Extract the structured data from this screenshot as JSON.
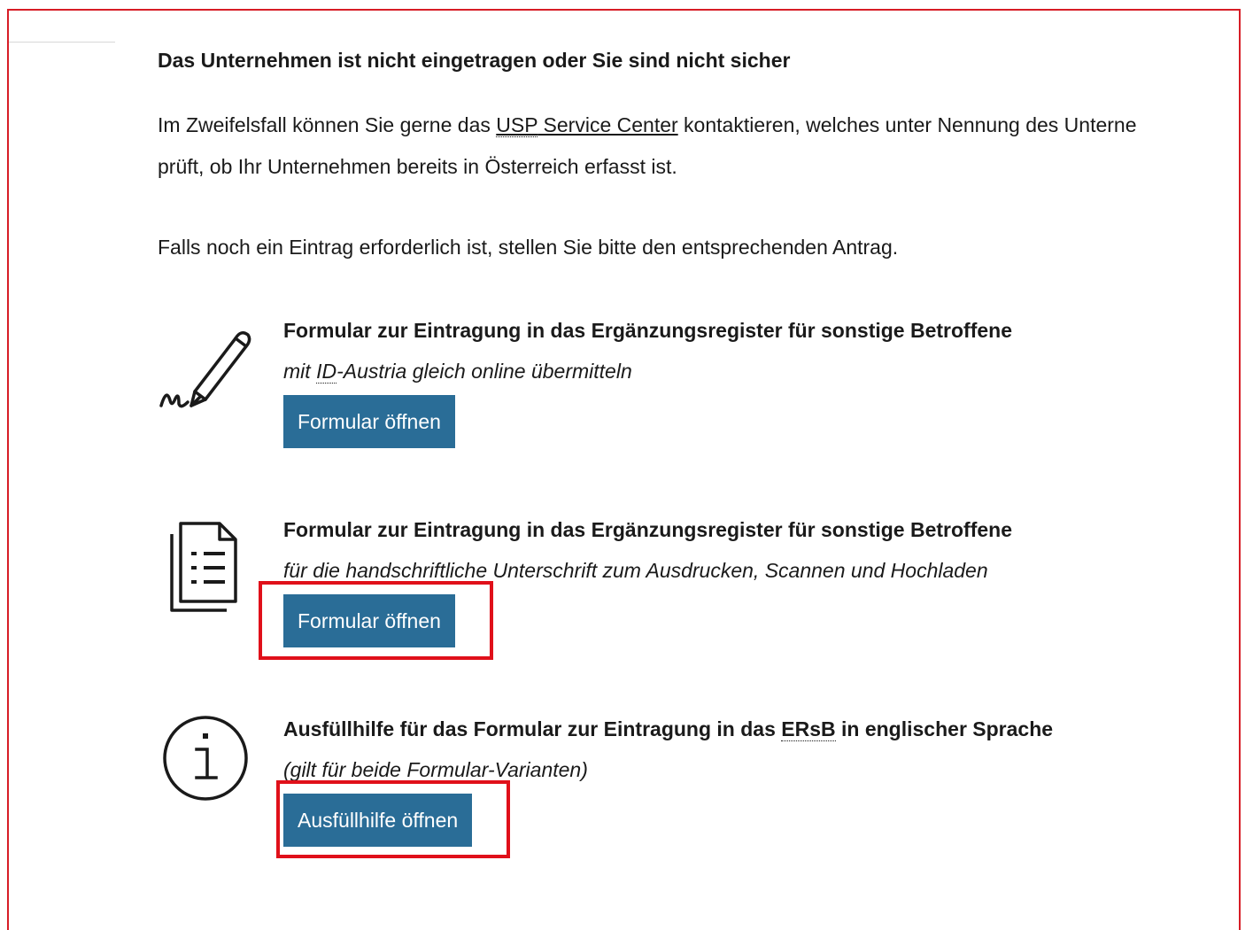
{
  "section": {
    "heading": "Das Unternehmen ist nicht eingetragen oder Sie sind nicht sicher",
    "intro_before_link": "Im Zweifelsfall können Sie gerne das ",
    "intro_link_abbr": "USP",
    "intro_link_rest": " Service Center",
    "intro_after_link": " kontaktieren, welches unter Nennung des Unterne",
    "intro_line2": "prüft, ob Ihr Unternehmen bereits in Österreich erfasst ist.",
    "hint": "Falls noch ein Eintrag erforderlich ist, stellen Sie bitte den entsprechenden Antrag."
  },
  "blocks": [
    {
      "icon": "pen-signature-icon",
      "title": "Formular zur Eintragung in das Ergänzungsregister für sonstige Betroffene",
      "subtitle_before_abbr": "mit ",
      "subtitle_abbr": "ID",
      "subtitle_after_abbr": "-Austria gleich online übermitteln",
      "button_label": "Formular öffnen"
    },
    {
      "icon": "document-list-icon",
      "title": "Formular zur Eintragung in das Ergänzungsregister für sonstige Betroffene",
      "subtitle": "für die handschriftliche Unterschrift zum Ausdrucken, Scannen und Hochladen",
      "button_label": "Formular öffnen"
    },
    {
      "icon": "info-icon",
      "title_before_abbr": "Ausfüllhilfe für das Formular zur Eintragung in das ",
      "title_abbr": "ERsB",
      "title_after_abbr": " in englischer Sprache",
      "subtitle": "(gilt für beide Formular-Varianten)",
      "button_label": "Ausfüllhilfe öffnen"
    }
  ],
  "colors": {
    "button_bg": "#2a6d97",
    "frame_border": "#d71d26",
    "highlight_border": "#e0101a"
  }
}
